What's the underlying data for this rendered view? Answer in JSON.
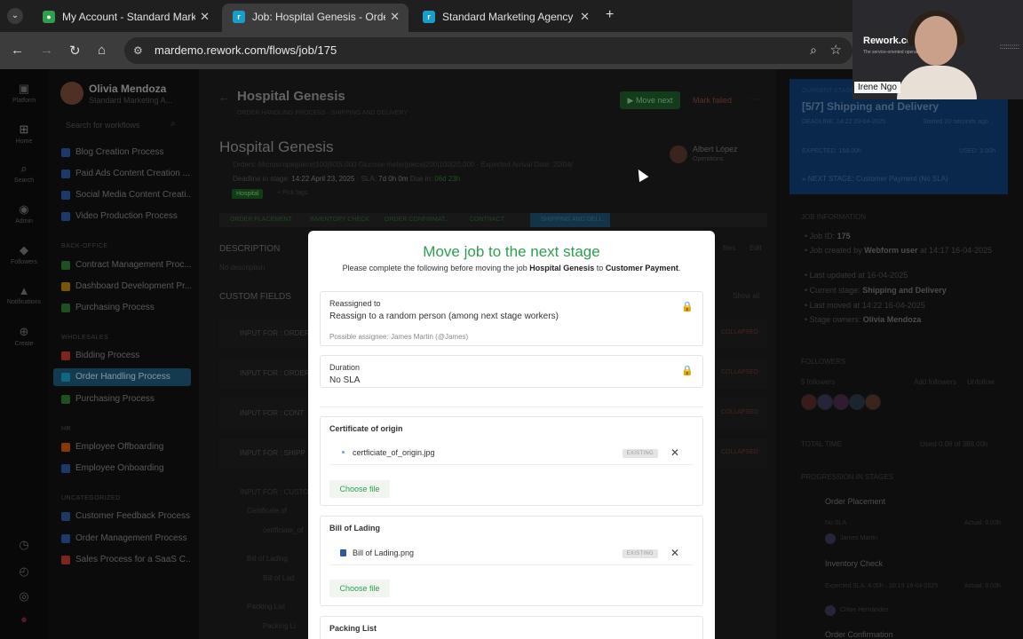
{
  "browser": {
    "tabs": [
      {
        "title": "My Account - Standard Marketi",
        "icon_color": "#2e9e4f"
      },
      {
        "title": "Job: Hospital Genesis - Order H",
        "icon_color": "#1a9dc9"
      },
      {
        "title": "Standard Marketing Agency",
        "icon_color": "#1a9dc9"
      }
    ],
    "url": "mardemo.rework.com/flows/job/175"
  },
  "rail": [
    {
      "label": "Platform",
      "icon": "platform-icon"
    },
    {
      "label": "Home",
      "icon": "home-icon"
    },
    {
      "label": "Search",
      "icon": "search-icon"
    },
    {
      "label": "Admin",
      "icon": "admin-icon"
    },
    {
      "label": "Followers",
      "icon": "followers-icon"
    },
    {
      "label": "Notifications",
      "icon": "bell-icon"
    },
    {
      "label": "Create",
      "icon": "plus-icon"
    }
  ],
  "sidebar": {
    "user_name": "Olivia Mendoza",
    "user_org": "Standard Marketing A...",
    "search_placeholder": "Search for workflows",
    "items": [
      {
        "label": "Blog Creation Process",
        "color": "#2c5aa0"
      },
      {
        "label": "Paid Ads Content Creation ...",
        "color": "#2c5aa0"
      },
      {
        "label": "Social Media Content Creati...",
        "color": "#2c5aa0"
      },
      {
        "label": "Video Production Process",
        "color": "#2c5aa0"
      },
      {
        "label": "Contract Management Proc...",
        "color": "#2e7d32"
      },
      {
        "label": "Dashboard Development Pr...",
        "color": "#b8860b"
      },
      {
        "label": "Purchasing Process",
        "color": "#2e7d32"
      },
      {
        "label": "Bidding Process",
        "color": "#c0392b"
      },
      {
        "label": "Order Handling Process",
        "color": "#1a9dc9"
      },
      {
        "label": "Purchasing Process",
        "color": "#2e7d32"
      },
      {
        "label": "Employee Offboarding",
        "color": "#d35400"
      },
      {
        "label": "Employee Onboarding",
        "color": "#2c5aa0"
      },
      {
        "label": "Customer Feedback Process",
        "color": "#2c5aa0"
      },
      {
        "label": "Order Management Process",
        "color": "#2c5aa0"
      },
      {
        "label": "Sales Process for a SaaS C...",
        "color": "#c0392b"
      }
    ],
    "sections": [
      "Back-office",
      "Wholesales",
      "HR",
      "Uncategorized"
    ]
  },
  "job": {
    "title": "Hospital Genesis",
    "sub": "ORDER HANDLING PROCESS · SHIPPING AND DELIVERY",
    "move_next": "Move next",
    "mark_failed": "Mark failed",
    "orders": "Orders: Microscope|piece|100|50|5,000 Glucose meter|piece|200|100|20,000 · Expected Arrival Date: 20/04/",
    "deadline_label": "Deadline in stage: ",
    "deadline": "14:22 April 23, 2025",
    "sla": " · SLA: ",
    "sla_value": "7d 0h 0m",
    "due_label": " Due in: ",
    "due": "06d 23h",
    "tag": "Hospital",
    "pick_tags": "+ Pick tags",
    "owner_name": "Albert López",
    "owner_role": "Operations",
    "stages": [
      "ORDER PLACEMENT",
      "INVENTORY CHECK",
      "ORDER CONFIRMAT...",
      "CONTRACT",
      "SHIPPING AND DELI..."
    ],
    "description_head": "DESCRIPTION",
    "description": "No description",
    "files_link": "files",
    "edit_link": "Edit",
    "custom_fields": "CUSTOM FIELDS",
    "show_all": "Show all",
    "cf_rows": [
      "INPUT FOR : ORDER",
      "INPUT FOR : ORDER",
      "INPUT FOR : CONT",
      "INPUT FOR : SHIPP"
    ],
    "collapsed": "COLLAPSED",
    "input_custom": "INPUT FOR : CUSTO",
    "bg_items": [
      "Certificate of",
      "certficiate_of",
      "Bill of Lading",
      "Bill of Lad",
      "Packing List",
      "Packing Li"
    ]
  },
  "right": {
    "current_stage": "CURRENT STAGE",
    "stage_title": "[5/7] Shipping and Delivery",
    "deadline": "DEADLINE: 14:22 23-04-2025",
    "started": "Started 20 seconds ago",
    "expected": "EXPECTED: 168.00h",
    "used": "USED: 0.00h",
    "next_stage": "» NEXT STAGE: Customer Payment (No SLA)",
    "job_info_head": "JOB INFORMATION",
    "job_id_label": "Job ID: ",
    "job_id": "175",
    "created_by_pre": "Job created by ",
    "created_by": "Webform user",
    "created_by_post": " at 14:17 16-04-2025",
    "last_updated": "Last updated at 16-04-2025",
    "current_stage_label": "Current stage: ",
    "current_stage_val": "Shipping and Delivery",
    "last_moved": "Last moved at 14:22 16-04-2025",
    "stage_owners_label": "Stage owners: ",
    "stage_owners": "Olivia Mendoza",
    "followers_head": "FOLLOWERS",
    "followers_count": "5 followers",
    "add_followers": "Add followers",
    "unfollow": "Unfollow",
    "total_time": "TOTAL TIME",
    "total_used": "Used 0.06 of 388.00h",
    "progression": "PROGRESSION IN STAGES",
    "prog": [
      {
        "name": "Order Placement",
        "sla": "No SLA",
        "actual": "Actual: 0.03h",
        "person": "James Martin"
      },
      {
        "name": "Inventory Check",
        "sla": "Expected SLA: 4.00h · 10:19 16-04-2025",
        "actual": "Actual: 0.03h",
        "person": "Chloe Hernández"
      },
      {
        "name": "Order Confirmation",
        "sla": "",
        "actual": "",
        "person": ""
      }
    ]
  },
  "modal": {
    "title": "Move job to the next stage",
    "desc_pre": "Please complete the following before moving the job ",
    "job_name": "Hospital Genesis",
    "desc_mid": " to ",
    "next_stage": "Customer Payment",
    "desc_post": ".",
    "reassigned_label": "Reassigned to",
    "reassigned_value": "Reassign to a random person (among next stage workers)",
    "possible_label": "Possible assignee: ",
    "possible_value": "James Martin (@James)",
    "duration_label": "Duration",
    "duration_value": "No SLA",
    "cert_label": "Certificate of origin",
    "cert_file": "certficiate_of_origin.jpg",
    "existing": "EXISTING",
    "choose_file": "Choose file",
    "bill_label": "Bill of Lading",
    "bill_file": "Bill of Lading.png",
    "packing_label": "Packing List"
  },
  "webcam": {
    "logo": "Rework.com",
    "tagline": "The service-oriented operation platform",
    "name": "Irene Ngo"
  }
}
